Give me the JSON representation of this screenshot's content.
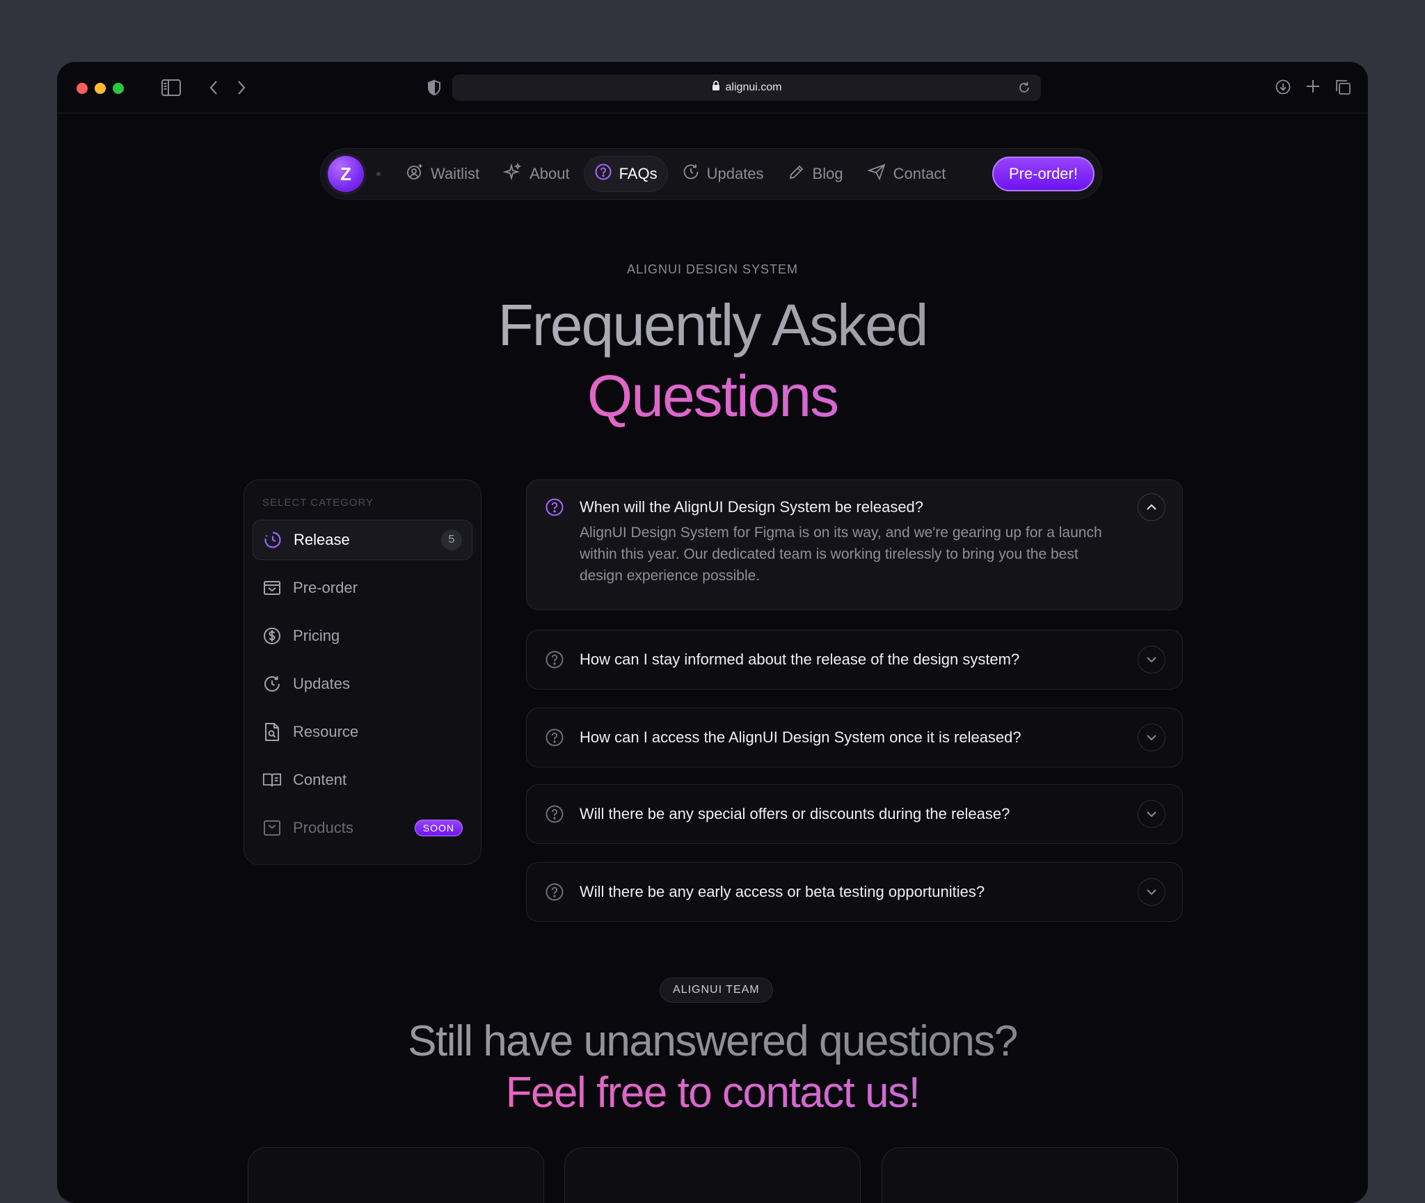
{
  "browser": {
    "url": "alignui.com",
    "traffic_lights": [
      "#ff5f57",
      "#febc2e",
      "#28c840"
    ]
  },
  "nav": {
    "logo_glyph": "Z",
    "items": [
      {
        "label": "Waitlist",
        "icon": "waitlist-icon"
      },
      {
        "label": "About",
        "icon": "sparkle-icon"
      },
      {
        "label": "FAQs",
        "icon": "question-icon",
        "active": true
      },
      {
        "label": "Updates",
        "icon": "updates-icon"
      },
      {
        "label": "Blog",
        "icon": "pencil-icon"
      },
      {
        "label": "Contact",
        "icon": "send-icon"
      }
    ],
    "cta": "Pre-order!",
    "accent": "#7c2cf5"
  },
  "hero": {
    "eyebrow": "ALIGNUI DESIGN SYSTEM",
    "title_line1": "Frequently Asked",
    "title_line2": "Questions"
  },
  "categories": {
    "title": "SELECT CATEGORY",
    "items": [
      {
        "label": "Release",
        "icon": "release-icon",
        "count": "5",
        "active": true
      },
      {
        "label": "Pre-order",
        "icon": "archive-icon"
      },
      {
        "label": "Pricing",
        "icon": "dollar-icon"
      },
      {
        "label": "Updates",
        "icon": "updates-icon"
      },
      {
        "label": "Resource",
        "icon": "file-search-icon"
      },
      {
        "label": "Content",
        "icon": "book-icon"
      },
      {
        "label": "Products",
        "icon": "inbox-icon",
        "badge": "SOON",
        "disabled": true
      }
    ]
  },
  "faqs": [
    {
      "question": "When will the AlignUI Design System be released?",
      "answer": "AlignUI Design System for Figma is on its way, and we're gearing up for a launch within this year. Our dedicated team is working tirelessly to bring you the best design experience possible.",
      "open": true
    },
    {
      "question": "How can I stay informed about the release of the design system?"
    },
    {
      "question": "How can I access the AlignUI Design System once it is released?"
    },
    {
      "question": "Will there be any special offers or discounts during the release?"
    },
    {
      "question": "Will there be any early access or beta testing opportunities?"
    }
  ],
  "contact": {
    "eyebrow": "ALIGNUI TEAM",
    "title_line1": "Still have unanswered questions?",
    "title_line2": "Feel free to contact us!"
  }
}
